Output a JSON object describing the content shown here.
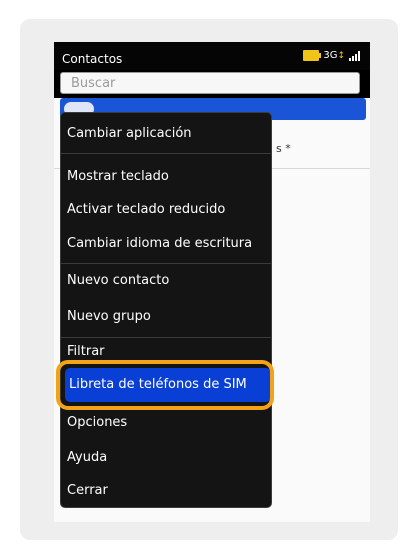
{
  "statusbar": {
    "app_title": "Contactos",
    "network": "3G",
    "network_indicator": "↕"
  },
  "search": {
    "placeholder": "Buscar"
  },
  "contacts": {
    "partial_text": "s *"
  },
  "menu": {
    "items": [
      {
        "label": "Cambiar aplicación"
      },
      {
        "label": "Mostrar teclado"
      },
      {
        "label": "Activar teclado reducido"
      },
      {
        "label": "Cambiar idioma de escritura"
      },
      {
        "label": "Nuevo contacto"
      },
      {
        "label": "Nuevo grupo"
      },
      {
        "label": "Filtrar"
      },
      {
        "label": "Libreta de teléfonos de SIM",
        "selected": true
      },
      {
        "label": "Opciones"
      },
      {
        "label": "Ayuda"
      },
      {
        "label": "Cerrar"
      }
    ]
  },
  "colors": {
    "highlight_blue": "#0a3fd6",
    "annotation_orange": "#f2a317",
    "battery_yellow": "#f0c419",
    "close_red": "#c0252b"
  }
}
